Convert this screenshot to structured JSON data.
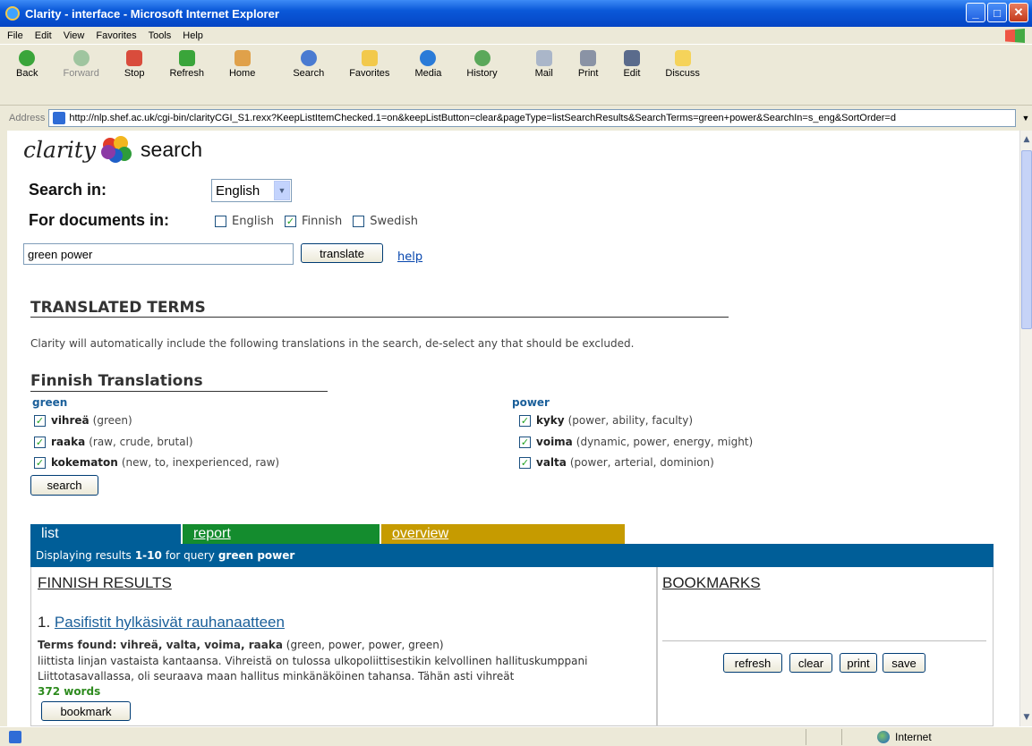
{
  "window": {
    "title": "Clarity - interface - Microsoft Internet Explorer",
    "controls": [
      "_",
      "□",
      "✕"
    ]
  },
  "menu": [
    "File",
    "Edit",
    "View",
    "Favorites",
    "Tools",
    "Help"
  ],
  "toolbar": {
    "buttons": [
      {
        "label": "Back",
        "color": "#3aa53a"
      },
      {
        "label": "Forward",
        "color": "#9fc59f"
      },
      {
        "label": "Stop",
        "color": "#d94c3c"
      },
      {
        "label": "Refresh",
        "color": "#3aa53a"
      },
      {
        "label": "Home",
        "color": "#e0a14a"
      },
      {
        "label": "Search",
        "color": "#4a7bd1"
      },
      {
        "label": "Favorites",
        "color": "#f2c94c"
      },
      {
        "label": "Media",
        "color": "#2a7bd8"
      },
      {
        "label": "History",
        "color": "#5aa85a"
      },
      {
        "label": "Mail",
        "color": "#aab6c9"
      },
      {
        "label": "Print",
        "color": "#8a93a5"
      },
      {
        "label": "Edit",
        "color": "#5a6b8c"
      },
      {
        "label": "Discuss",
        "color": "#f5d35a"
      }
    ]
  },
  "address": {
    "label": "Address",
    "url": "http://nlp.shef.ac.uk/cgi-bin/clarityCGI_S1.rexx?KeepListItemChecked.1=on&keepListButton=clear&pageType=listSearchResults&SearchTerms=green+power&SearchIn=s_eng&SortOrder=d"
  },
  "page": {
    "logo_word": "clarity",
    "logo_search": "search",
    "search_in_label": "Search in:",
    "search_in_value": "English",
    "for_docs_label": "For documents in:",
    "doc_languages": [
      {
        "label": "English",
        "checked": false
      },
      {
        "label": "Finnish",
        "checked": true
      },
      {
        "label": "Swedish",
        "checked": false
      }
    ],
    "query": "green power",
    "translate_button": "translate",
    "help_link": "help",
    "translated_heading": "TRANSLATED TERMS",
    "translated_note": "Clarity will automatically include the following translations in the search, de-select any that should be excluded.",
    "finnish_heading": "Finnish Translations",
    "groups": [
      {
        "term": "green",
        "items": [
          {
            "word": "vihreä",
            "gloss": "(green)",
            "checked": true
          },
          {
            "word": "raaka",
            "gloss": "(raw, crude, brutal)",
            "checked": true
          },
          {
            "word": "kokematon",
            "gloss": "(new, to, inexperienced, raw)",
            "checked": true
          }
        ]
      },
      {
        "term": "power",
        "items": [
          {
            "word": "kyky",
            "gloss": "(power, ability, faculty)",
            "checked": true
          },
          {
            "word": "voima",
            "gloss": "(dynamic, power, energy, might)",
            "checked": true
          },
          {
            "word": "valta",
            "gloss": "(power, arterial, dominion)",
            "checked": true
          }
        ]
      }
    ],
    "search_button": "search",
    "tabs": [
      {
        "label": "list",
        "color": "#005e98"
      },
      {
        "label": "report",
        "color": "#148c2e"
      },
      {
        "label": "overview",
        "color": "#c69b00"
      }
    ],
    "results_bar": {
      "prefix": "Displaying results",
      "range": "1-10",
      "mid": "for query",
      "query": "green power"
    },
    "finnish_results_title": "FINNISH RESULTS",
    "bookmarks_title": "BOOKMARKS",
    "bookmark_buttons": [
      "refresh",
      "clear",
      "print",
      "save"
    ],
    "result": {
      "number": "1.",
      "title": "Pasifistit hylkäsivät rauhanaatteen",
      "terms_label": "Terms found:",
      "terms": "vihreä, valta, voima, raaka",
      "terms_gloss": "(green, power, power, green)",
      "snippet1": "liittista linjan vastaista kantaansa. Vihreistä on tulossa ulkopoliittisestikin kelvollinen hallituskumppani",
      "snippet2": "Liittotasavallassa, oli seuraava maan hallitus minkänäköinen tahansa. Tähän asti vihreät",
      "words": "372 words",
      "bookmark_button": "bookmark"
    }
  },
  "status": {
    "zone": "Internet"
  }
}
